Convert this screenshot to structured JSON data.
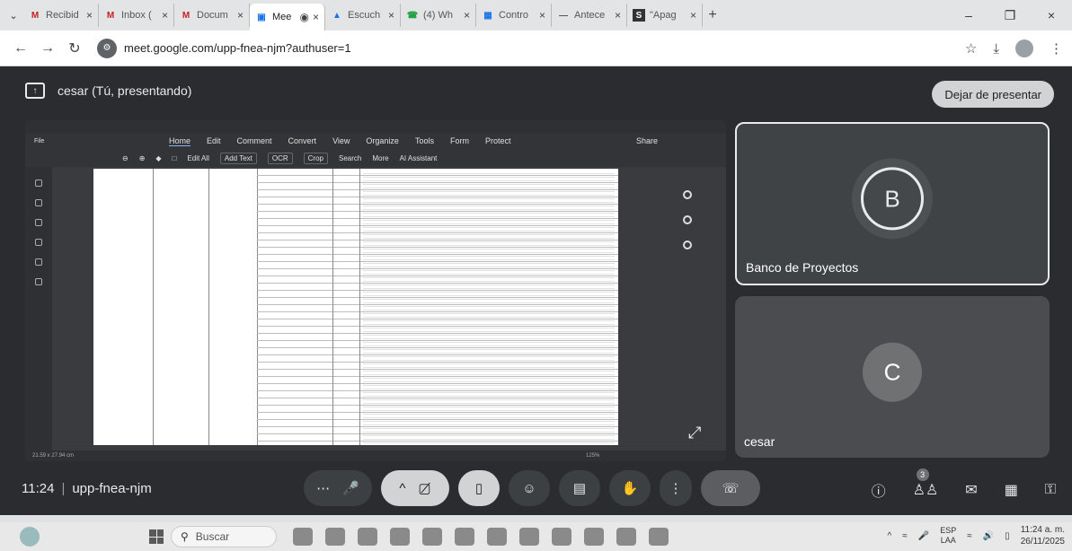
{
  "browser": {
    "tabs": [
      {
        "icon": "M",
        "label": "Recibid",
        "active": false
      },
      {
        "icon": "M",
        "label": "Inbox (",
        "active": false
      },
      {
        "icon": "M",
        "label": "Docum",
        "active": false
      },
      {
        "icon": "meet",
        "label": "Mee",
        "active": true
      },
      {
        "icon": "play",
        "label": "Escuch",
        "active": false
      },
      {
        "icon": "wa",
        "label": "(4) Wh",
        "active": false
      },
      {
        "icon": "doc",
        "label": "Contro",
        "active": false
      },
      {
        "icon": "dash",
        "label": "Antece",
        "active": false
      },
      {
        "icon": "S",
        "label": "\"Apag",
        "active": false
      }
    ],
    "url": "meet.google.com/upp-fnea-njm?authuser=1"
  },
  "meet": {
    "presenter_label": "cesar (Tú, presentando)",
    "stop_presenting": "Dejar de presentar",
    "meeting_time": "11:24",
    "meeting_code": "upp-fnea-njm",
    "participants_count": "3",
    "participants": [
      {
        "initial": "B",
        "name": "Banco de Proyectos"
      },
      {
        "initial": "C",
        "name": "cesar"
      }
    ]
  },
  "shared_screen": {
    "pdf_menu": [
      "Home",
      "Edit",
      "Comment",
      "Convert",
      "View",
      "Organize",
      "Tools",
      "Form",
      "Protect"
    ],
    "pdf_file": "File",
    "pdf_tools": [
      "Edit All",
      "Add Text",
      "OCR",
      "Crop",
      "Search",
      "More",
      "AI Assistant"
    ],
    "share_label": "Share",
    "page_size": "21.59 x 27.94 cm",
    "zoom": "125%"
  },
  "taskbar": {
    "search_placeholder": "Buscar",
    "lang_top": "ESP",
    "lang_bottom": "LAA",
    "clock_time": "11:24 a. m.",
    "clock_date": "26/11/2025"
  }
}
